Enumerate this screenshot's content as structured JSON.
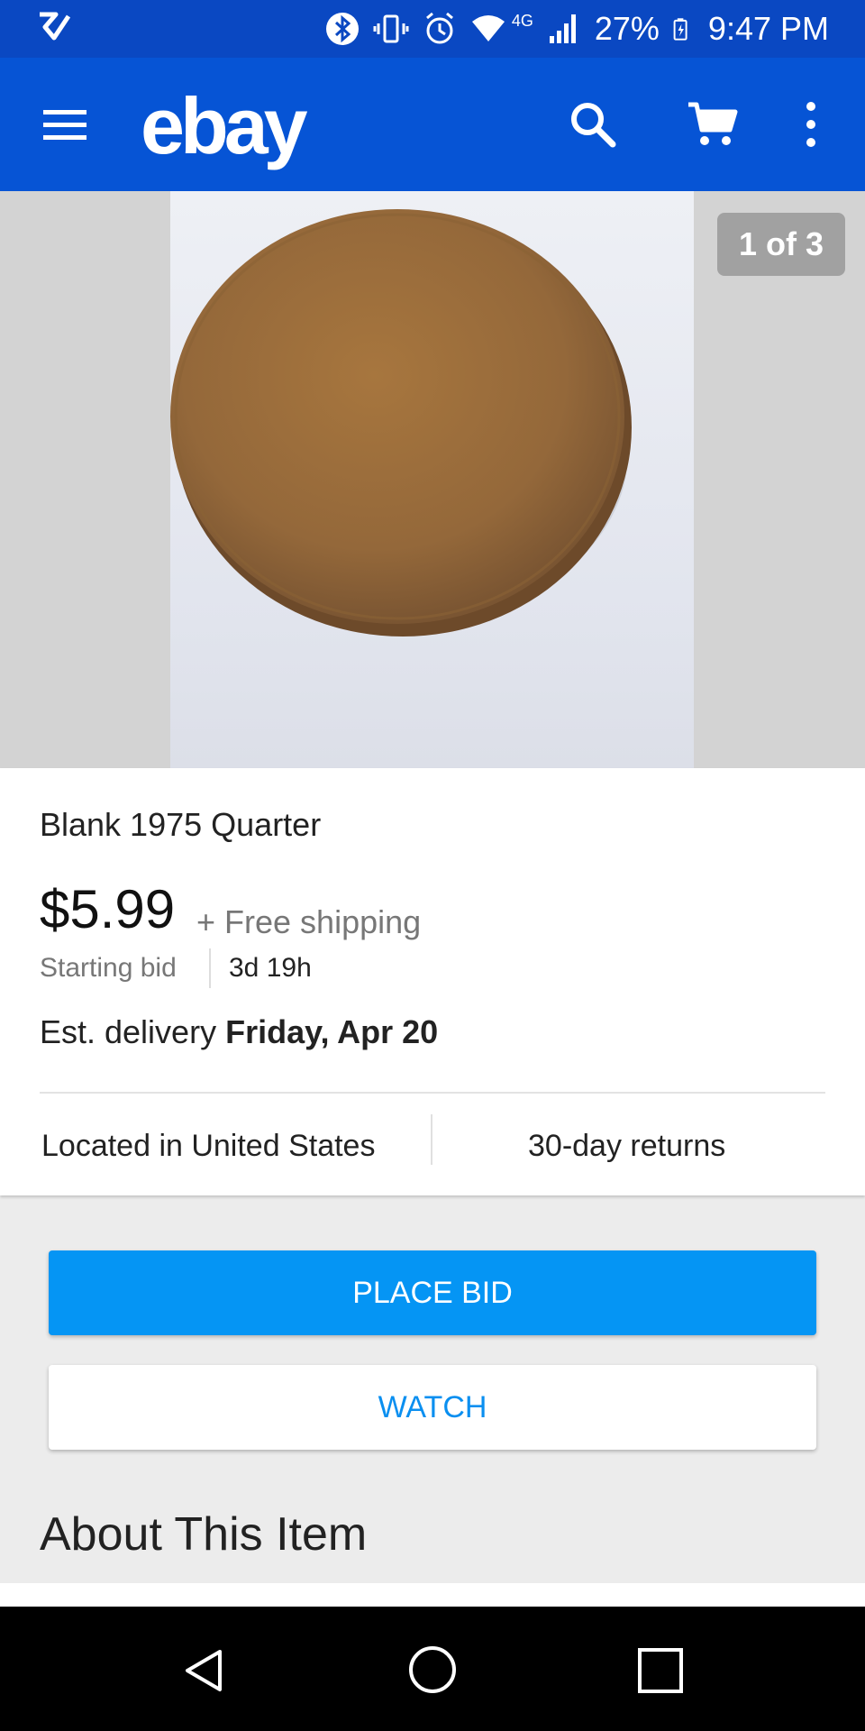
{
  "status_bar": {
    "time": "9:47 PM",
    "battery": "27%",
    "network": "4G"
  },
  "app_bar": {
    "logo": "ebay",
    "icons": [
      "menu-icon",
      "search-icon",
      "cart-icon",
      "more-vert-icon"
    ]
  },
  "gallery": {
    "counter": "1 of 3"
  },
  "item": {
    "title": "Blank 1975 Quarter",
    "price": "$5.99",
    "shipping": "+ Free shipping",
    "bid_label": "Starting bid",
    "time_left": "3d 19h",
    "delivery_label": "Est. delivery",
    "delivery_date": "Friday, Apr 20",
    "location": "Located in United States",
    "returns": "30-day returns"
  },
  "actions": {
    "place_bid": "PLACE BID",
    "watch": "WATCH"
  },
  "about": {
    "title": "About This Item"
  },
  "colors": {
    "status_bar": "#0a48c2",
    "app_bar": "#0654d5",
    "primary_button": "#0595f4",
    "watch_text": "#0a8ff0"
  }
}
